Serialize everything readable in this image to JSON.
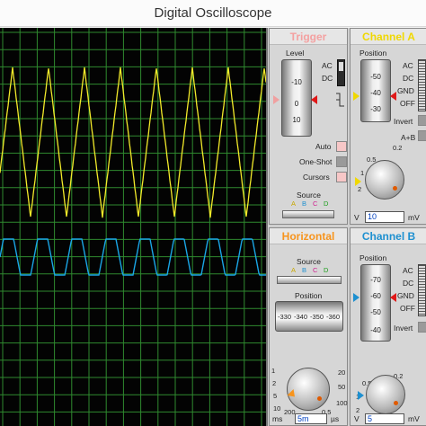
{
  "window": {
    "title": "Digital Oscilloscope"
  },
  "trigger": {
    "title": "Trigger",
    "title_color": "#f4a0a0",
    "level_label": "Level",
    "level_ticks": [
      "-10",
      "0",
      "10"
    ],
    "ac_label": "AC",
    "dc_label": "DC",
    "auto_label": "Auto",
    "oneshot_label": "One-Shot",
    "cursors_label": "Cursors",
    "source_label": "Source",
    "source_options": [
      "A",
      "B",
      "C",
      "D"
    ]
  },
  "channel_a": {
    "title": "Channel A",
    "title_color": "#f0d800",
    "position_label": "Position",
    "position_ticks": [
      "-50",
      "-40",
      "-30"
    ],
    "ac_label": "AC",
    "dc_label": "DC",
    "gnd_label": "GND",
    "off_label": "OFF",
    "invert_label": "Invert",
    "apb_label": "A+B",
    "knob_ticks": [
      "2",
      "1",
      "0.5",
      "0.2"
    ],
    "unit_left": "V",
    "unit_right": "mV",
    "value": "10"
  },
  "horizontal": {
    "title": "Horizontal",
    "title_color": "#f7941d",
    "source_label": "Source",
    "source_options": [
      "A",
      "B",
      "C",
      "D"
    ],
    "position_label": "Position",
    "position_ticks": [
      "-330",
      "-340",
      "-350",
      "-360"
    ],
    "knob_ticks": [
      "1",
      "2",
      "5",
      "10",
      "20",
      "50",
      "100",
      "200",
      "0.5"
    ],
    "unit_left": "ms",
    "unit_right": "µs",
    "value": "5m"
  },
  "channel_b": {
    "title": "Channel B",
    "title_color": "#1e90d0",
    "position_label": "Position",
    "position_ticks": [
      "-70",
      "-60",
      "-50",
      "-40"
    ],
    "ac_label": "AC",
    "dc_label": "DC",
    "gnd_label": "GND",
    "off_label": "OFF",
    "invert_label": "Invert",
    "knob_ticks": [
      "2",
      "1",
      "0.5",
      "0.2"
    ],
    "unit_left": "V",
    "unit_right": "mV",
    "value": "5"
  },
  "traces": [
    {
      "channel": "A",
      "color": "#f2ea2a",
      "shape": "triangle",
      "cycles": 7.4
    },
    {
      "channel": "B",
      "color": "#1aa6e6",
      "shape": "trapezoid",
      "cycles": 7.8
    }
  ]
}
